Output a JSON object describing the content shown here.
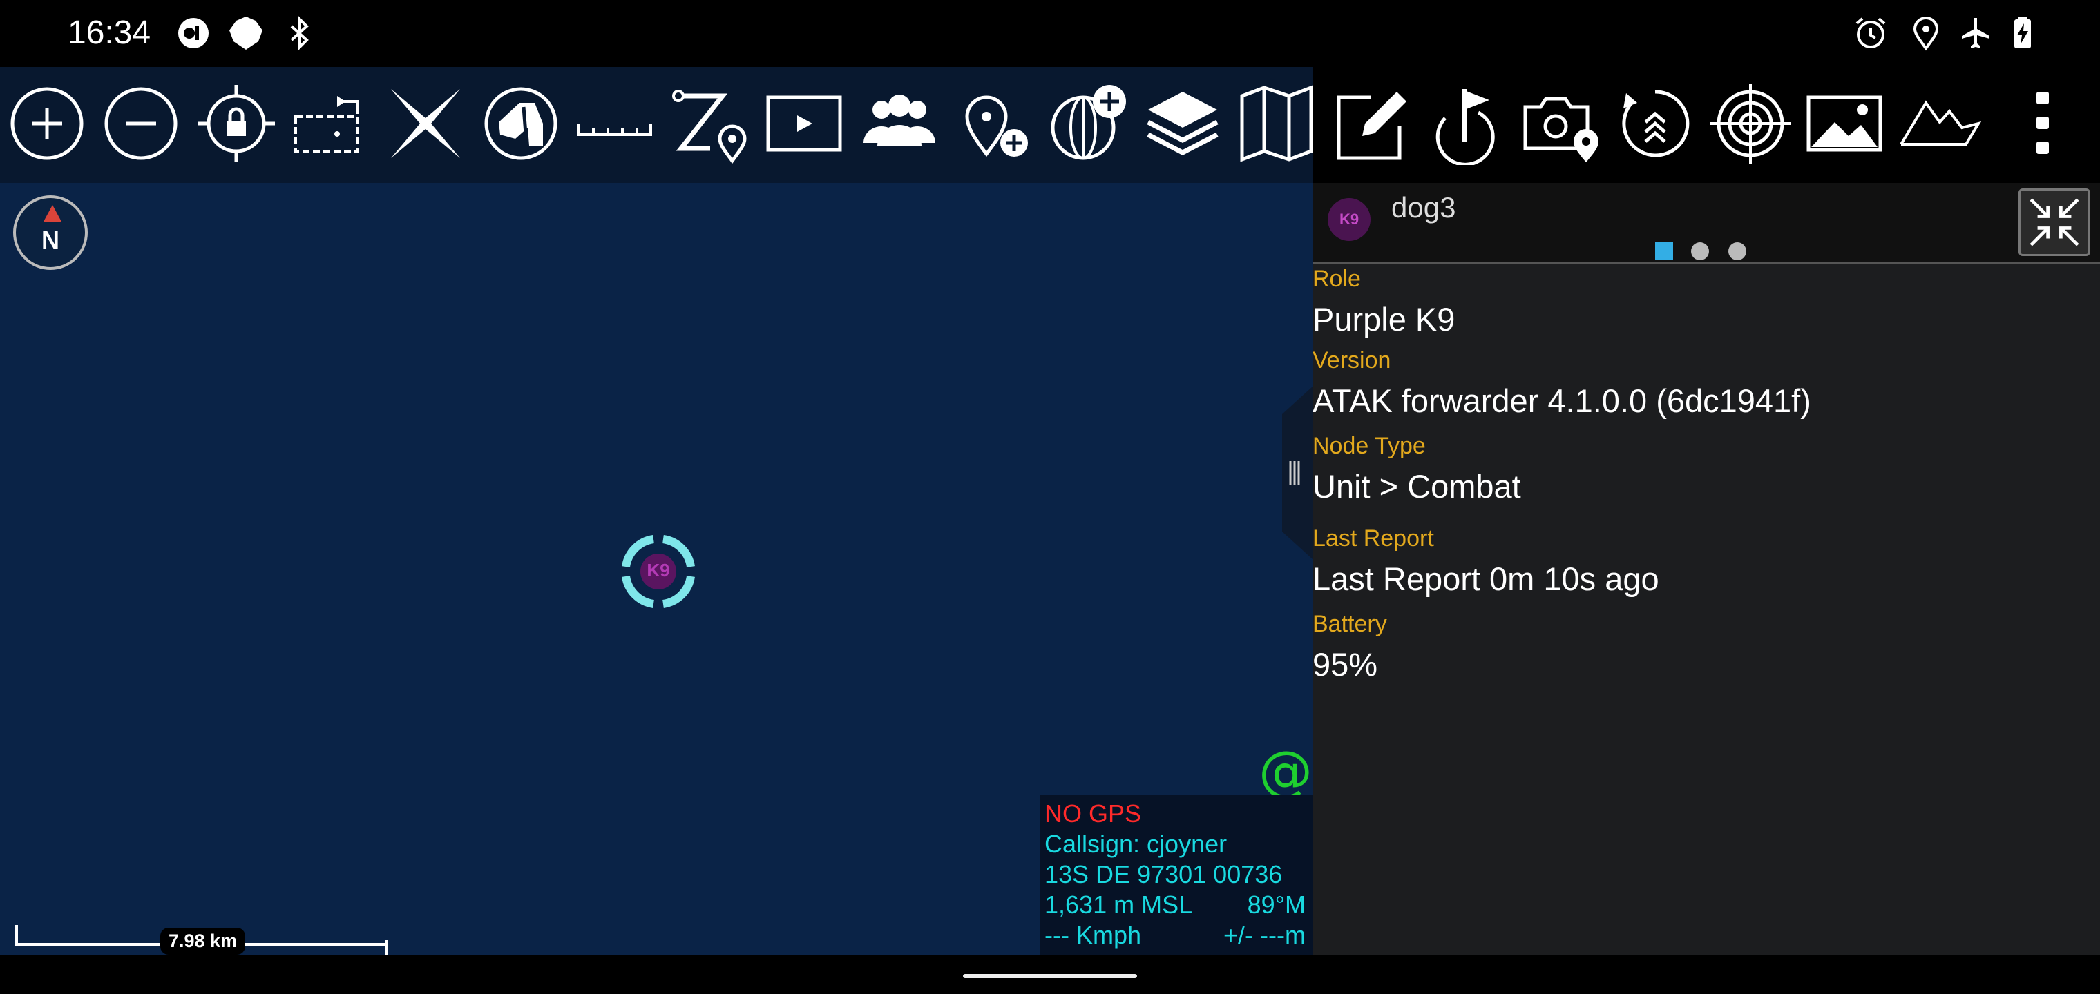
{
  "status_bar": {
    "time": "16:34",
    "left_icons": [
      "vpn-key-icon",
      "shield-icon",
      "bluetooth-icon"
    ],
    "right_icons": [
      "alarm-icon",
      "location-pin-icon",
      "airplane-icon",
      "battery-charging-icon"
    ]
  },
  "toolbar": {
    "buttons": [
      "zoom-in-icon",
      "zoom-out-icon",
      "lock-location-icon",
      "rotate-map-icon",
      "cancel-x-icon",
      "k9-icon",
      "ruler-icon",
      "route-icon",
      "video-icon",
      "contacts-icon",
      "add-point-icon",
      "add-globe-icon",
      "layers-icon",
      "map-icon",
      "edit-icon",
      "checkpoint-flag-icon",
      "geo-photo-icon",
      "bloodhound-icon",
      "target-icon",
      "image-gallery-icon",
      "elevation-icon",
      "overflow-menu-icon"
    ]
  },
  "map": {
    "compass_label": "N",
    "scale_label": "7.98 km",
    "info": {
      "gps_status": "NO GPS",
      "callsign": "Callsign: cjoyner",
      "mgrs": "13S  DE  97301  00736",
      "altitude": "1,631 m MSL",
      "heading": "89°M",
      "speed": "--- Kmph",
      "accuracy": "+/- ---m"
    },
    "marker_label": "K9",
    "chat_icon": "@"
  },
  "detail": {
    "callsign": "dog3",
    "avatar_label": "K9",
    "page_dots": 3,
    "active_dot": 0,
    "fields": [
      {
        "label": "Role",
        "value": "Purple K9"
      },
      {
        "label": "Version",
        "value": "ATAK forwarder 4.1.0.0 (6dc1941f)"
      },
      {
        "label": "Node Type",
        "value": "Unit > Combat"
      },
      {
        "label": "Last Report",
        "value": "Last Report 0m 10s ago"
      },
      {
        "label": "Battery",
        "value": "95%"
      }
    ]
  },
  "colors": {
    "map_bg": "#0a2347",
    "label_gold": "#e3a91d",
    "info_cyan": "#19d9e0",
    "nogps_red": "#ff2a2a",
    "chat_green": "#1fcf2f",
    "accent_blue": "#33aee5"
  }
}
